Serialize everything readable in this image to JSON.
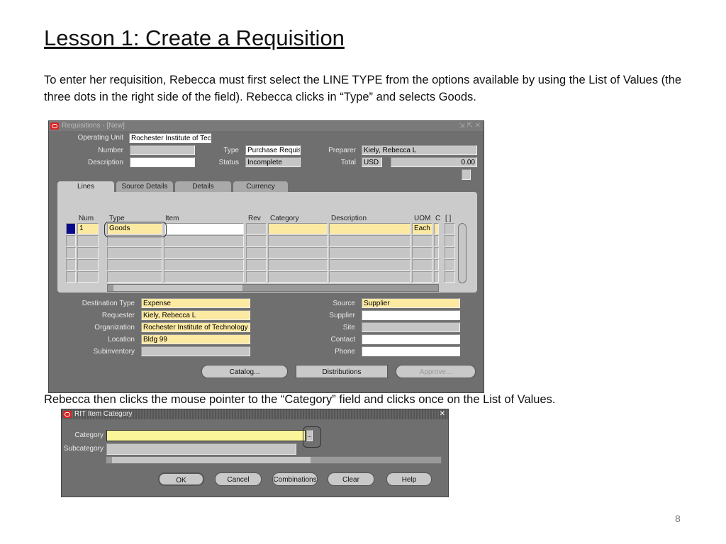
{
  "slide": {
    "title": "Lesson 1:  Create a Requisition",
    "intro": "To enter her requisition, Rebecca must first select the LINE TYPE  from the options available by using the List of Values (the three dots in the right side of the field).  Rebecca clicks in “Type” and selects Goods.",
    "caption": "Rebecca then clicks the mouse pointer to the “Category” field and clicks once on the List of Values.",
    "page_number": "8"
  },
  "requisition_window": {
    "title": "Requisitions - [New]",
    "header": {
      "operating_unit_label": "Operating Unit",
      "operating_unit": "Rochester Institute of Technology",
      "number_label": "Number",
      "number": "",
      "description_label": "Description",
      "description": "",
      "type_label": "Type",
      "type": "Purchase Requisition",
      "status_label": "Status",
      "status": "Incomplete",
      "preparer_label": "Preparer",
      "preparer": "Kiely, Rebecca L",
      "total_label": "Total",
      "currency": "USD",
      "total": "0.00"
    },
    "tabs": [
      "Lines",
      "Source Details",
      "Details",
      "Currency"
    ],
    "active_tab": "Lines",
    "columns": [
      "Num",
      "Type",
      "Item",
      "Rev",
      "Category",
      "Description",
      "UOM",
      "C",
      "[ ]"
    ],
    "rows": [
      {
        "num": "1",
        "type": "Goods",
        "item": "",
        "rev": "",
        "category": "",
        "description": "",
        "uom": "Each"
      },
      {
        "num": "",
        "type": "",
        "item": "",
        "rev": "",
        "category": "",
        "description": "",
        "uom": ""
      },
      {
        "num": "",
        "type": "",
        "item": "",
        "rev": "",
        "category": "",
        "description": "",
        "uom": ""
      },
      {
        "num": "",
        "type": "",
        "item": "",
        "rev": "",
        "category": "",
        "description": "",
        "uom": ""
      },
      {
        "num": "",
        "type": "",
        "item": "",
        "rev": "",
        "category": "",
        "description": "",
        "uom": ""
      }
    ],
    "details": {
      "destination_type_label": "Destination Type",
      "destination_type": "Expense",
      "requester_label": "Requester",
      "requester": "Kiely, Rebecca L",
      "organization_label": "Organization",
      "organization": "Rochester Institute of Technology",
      "location_label": "Location",
      "location": "Bldg 99",
      "subinventory_label": "Subinventory",
      "subinventory": "",
      "source_label": "Source",
      "source": "Supplier",
      "supplier_label": "Supplier",
      "supplier": "",
      "site_label": "Site",
      "site": "",
      "contact_label": "Contact",
      "contact": "",
      "phone_label": "Phone",
      "phone": ""
    },
    "buttons": {
      "catalog": "Catalog...",
      "distributions": "Distributions",
      "approve": "Approve..."
    }
  },
  "category_window": {
    "title": "RIT Item Category",
    "category_label": "Category",
    "category": "",
    "subcategory_label": "Subcategory",
    "subcategory": "",
    "lov_button": "...",
    "buttons": {
      "ok": "OK",
      "cancel": "Cancel",
      "combinations": "Combinations",
      "clear": "Clear",
      "help": "Help"
    }
  },
  "colors": {
    "required_field": "#fce9a2",
    "active_field": "#fbf59a",
    "window_bg": "#6f6f6f",
    "panel_bg": "#cbcbcb"
  }
}
